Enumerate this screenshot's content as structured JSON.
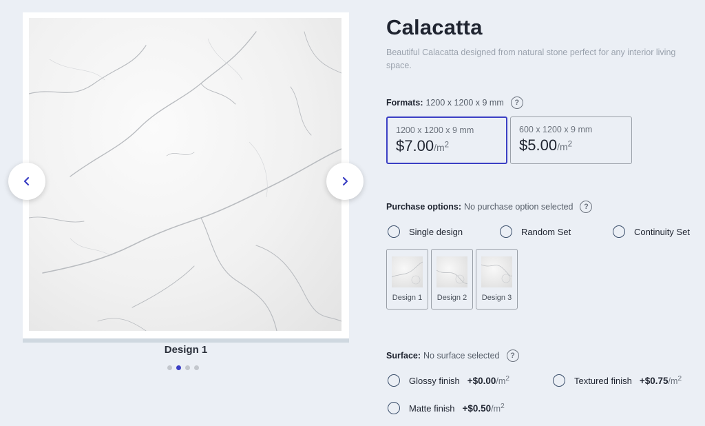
{
  "gallery": {
    "caption": "Design 1",
    "dots": 4,
    "active_dot": 1,
    "prev_icon": "chevron-left",
    "next_icon": "chevron-right"
  },
  "product": {
    "title": "Calacatta",
    "description": "Beautiful Calacatta designed from natural stone perfect for any interior living space."
  },
  "formats": {
    "label": "Formats:",
    "selected_text": "1200 x 1200 x 9 mm",
    "options": [
      {
        "dimensions": "1200 x 1200 x 9 mm",
        "price": "$7.00",
        "unit": "/m",
        "unit_sup": "2",
        "selected": true
      },
      {
        "dimensions": "600 x 1200 x 9 mm",
        "price": "$5.00",
        "unit": "/m",
        "unit_sup": "2",
        "selected": false
      }
    ]
  },
  "purchase": {
    "label": "Purchase options:",
    "status": "No purchase option selected",
    "options": [
      "Single design",
      "Random Set",
      "Continuity Set"
    ],
    "designs": [
      "Design 1",
      "Design 2",
      "Design 3"
    ]
  },
  "surface": {
    "label": "Surface:",
    "status": "No surface selected",
    "options": [
      {
        "name": "Glossy finish",
        "price": "+$0.00",
        "unit": "/m",
        "unit_sup": "2"
      },
      {
        "name": "Textured finish",
        "price": "+$0.75",
        "unit": "/m",
        "unit_sup": "2"
      },
      {
        "name": "Matte finish",
        "price": "+$0.50",
        "unit": "/m",
        "unit_sup": "2"
      }
    ]
  },
  "colors": {
    "accent": "#3b3fc4",
    "background": "#ebeff5",
    "radio_border": "#3a4e6a"
  }
}
